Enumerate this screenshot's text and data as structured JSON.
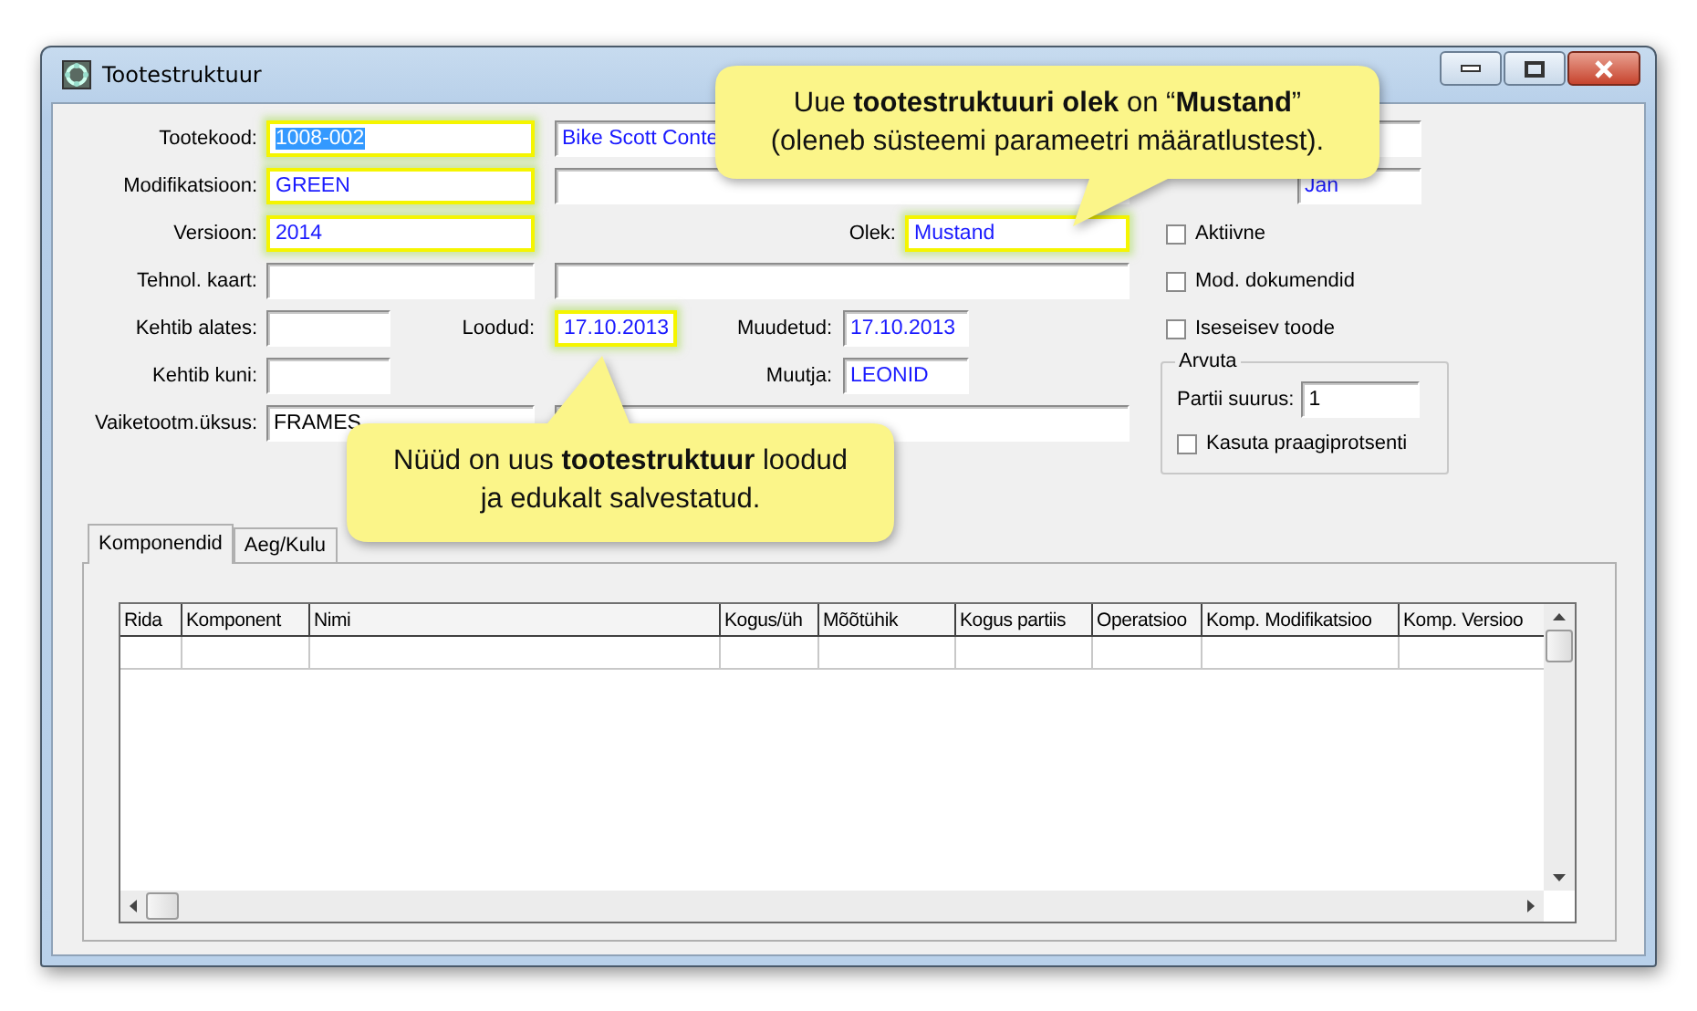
{
  "window": {
    "title": "Tootestruktuur"
  },
  "form": {
    "product_code": {
      "label": "Tootekood:",
      "value": "1008-002",
      "highlighted": true,
      "text_selected": true
    },
    "product_name": {
      "value": "Bike Scott Conte",
      "readonly": true,
      "highlighted": false
    },
    "modification": {
      "label": "Modifikatsioon:",
      "value": "GREEN",
      "readonly": true,
      "highlighted": true
    },
    "version": {
      "label": "Versioon:",
      "value": "2014",
      "readonly": true,
      "highlighted": true
    },
    "status": {
      "label": "Olek:",
      "value": "Mustand",
      "readonly": true,
      "highlighted": true
    },
    "tech_card": {
      "label": "Tehnol. kaart:",
      "highlighted": false
    },
    "valid_from": {
      "label": "Kehtib alates:",
      "highlighted": false
    },
    "created": {
      "label": "Loodud:",
      "value": "17.10.2013",
      "readonly": true,
      "highlighted": true
    },
    "modified": {
      "label": "Muudetud:",
      "value": "17.10.2013",
      "readonly": true,
      "highlighted": false
    },
    "valid_to": {
      "label": "Kehtib kuni:",
      "highlighted": false
    },
    "modifier": {
      "label": "Muutja:",
      "value": "LEONID",
      "readonly": true,
      "highlighted": false
    },
    "default_unit": {
      "label": "Vaiketootm.üksus:",
      "value": "FRAMES",
      "readonly": false,
      "highlighted": false
    },
    "right_field": {
      "value": "Jan",
      "readonly": true,
      "highlighted": false
    }
  },
  "checkboxes": [
    {
      "label": "Aktiivne",
      "checked": false
    },
    {
      "label": "Mod. dokumendid",
      "checked": false
    },
    {
      "label": "Iseseisev toode",
      "checked": false
    }
  ],
  "calculate_group": {
    "title": "Arvuta",
    "batch_size": {
      "label": "Partii suurus:",
      "value": "1"
    },
    "checkbox": {
      "label": "Kasuta praagiprotsenti",
      "checked": false
    }
  },
  "tabs": [
    {
      "label": "Komponendid",
      "selected": true
    },
    {
      "label": "Aeg/Kulu",
      "selected": false
    }
  ],
  "table": {
    "columns": [
      "Rida",
      "Komponent",
      "Nimi",
      "Kogus/üh",
      "Mõõtühik",
      "Kogus partiis",
      "Operatsioo",
      "Komp. Modifikatsioo",
      "Komp. Versioo"
    ]
  },
  "callouts": [
    {
      "text": "Uue **tootestruktuuri olek** on “**Mustand**”\n(oleneb süsteemi parameetri määratlustest)."
    },
    {
      "text": "Nüüd on uus **tootestruktuur** loodud\nja edukalt salvestatud."
    }
  ]
}
